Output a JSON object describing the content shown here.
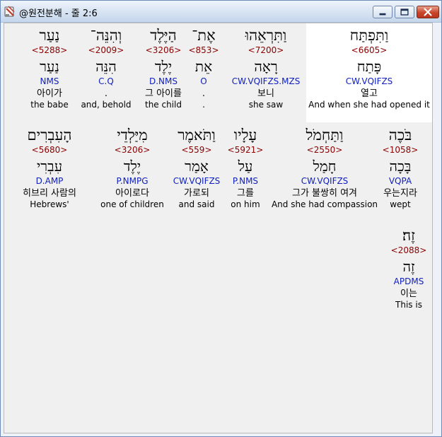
{
  "window": {
    "title": "@원전분해 - 줄 2:6",
    "icon": "app-book-icon"
  },
  "rows": [
    [
      {
        "heb": "וַתִּפְתַּח",
        "strong": "<6605>",
        "lemma": "פָּתַח",
        "morph": "CW.VQIFZS",
        "kor": "열고",
        "eng": "And when she had opened it",
        "selected": true
      },
      {
        "heb": "וַתִּרְאֵהוּ",
        "strong": "<7200>",
        "lemma": "רָאָה",
        "morph": "CW.VQIFZS.MZS",
        "kor": "보니",
        "eng": "she saw",
        "selected": false
      },
      {
        "heb": "אֶת־",
        "strong": "<853>",
        "lemma": "אֵת",
        "morph": "O",
        "kor": ".",
        "eng": ".",
        "selected": false
      },
      {
        "heb": "הַיֶּלֶד",
        "strong": "<3206>",
        "lemma": "יֶלֶד",
        "morph": "D.NMS",
        "kor": "그 아이를",
        "eng": "the child",
        "selected": false
      },
      {
        "heb": "וְהִנֵּה־",
        "strong": "<2009>",
        "lemma": "הִנֵּה",
        "morph": "C.Q",
        "kor": ".",
        "eng": "and, behold",
        "selected": false
      },
      {
        "heb": "נַעַר",
        "strong": "<5288>",
        "lemma": "נַעַר",
        "morph": "NMS",
        "kor": "아이가",
        "eng": "the babe",
        "selected": false
      }
    ],
    [
      {
        "heb": "בֹּכֶה",
        "strong": "<1058>",
        "lemma": "בָּכָה",
        "morph": "VQPA",
        "kor": "우는지라",
        "eng": "wept",
        "selected": false
      },
      {
        "heb": "וַתַּחְמֹל",
        "strong": "<2550>",
        "lemma": "חָמַל",
        "morph": "CW.VQIFZS",
        "kor": "그가 불쌍히 여겨",
        "eng": "And she had compassion",
        "selected": false
      },
      {
        "heb": "עָלָיו",
        "strong": "<5921>",
        "lemma": "עַל",
        "morph": "P.NMS",
        "kor": "그를",
        "eng": "on him",
        "selected": false
      },
      {
        "heb": "וַתֹּאמֶר",
        "strong": "<559>",
        "lemma": "אָמַר",
        "morph": "CW.VQIFZS",
        "kor": "가로되",
        "eng": "and said",
        "selected": false
      },
      {
        "heb": "מִיַּלְדֵי",
        "strong": "<3206>",
        "lemma": "יֶלֶד",
        "morph": "P.NMPG",
        "kor": "아이로다",
        "eng": "one of children",
        "selected": false
      },
      {
        "heb": "הָעִבְרִים",
        "strong": "<5680>",
        "lemma": "עִבְרִי",
        "morph": "D.AMP",
        "kor": "히브리 사람의",
        "eng": "Hebrews'",
        "selected": false
      }
    ],
    [
      {
        "heb": "זֶה׃",
        "strong": "<2088>",
        "lemma": "זֶה",
        "morph": "APDMS",
        "kor": "이는",
        "eng": "This is",
        "selected": false
      }
    ]
  ]
}
